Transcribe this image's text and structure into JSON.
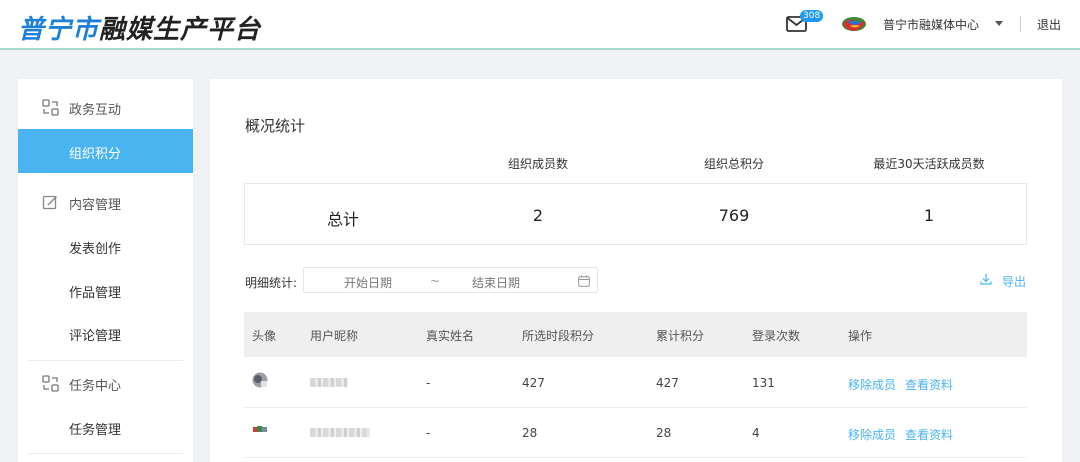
{
  "header": {
    "logo_part1": "普宁市",
    "logo_part2": "融媒生产平台",
    "mail_badge": "308",
    "org_name": "普宁市融媒体中心",
    "logout": "退出"
  },
  "sidebar": {
    "groups": [
      {
        "label": "政务互动",
        "icon": "exchange-icon",
        "items": [
          {
            "label": "组织积分",
            "active": true
          }
        ]
      },
      {
        "label": "内容管理",
        "icon": "edit-icon",
        "items": [
          {
            "label": "发表创作"
          },
          {
            "label": "作品管理"
          },
          {
            "label": "评论管理"
          }
        ]
      },
      {
        "label": "任务中心",
        "icon": "exchange-icon",
        "items": [
          {
            "label": "任务管理"
          }
        ]
      }
    ]
  },
  "main": {
    "title": "概况统计",
    "stat_headers": [
      "组织成员数",
      "组织总积分",
      "最近30天活跃成员数"
    ],
    "stat_row_label": "总计",
    "stat_values": [
      "2",
      "769",
      "1"
    ],
    "detail_label": "明细统计:",
    "date_start_placeholder": "开始日期",
    "date_sep": "~",
    "date_end_placeholder": "结束日期",
    "export_label": "导出",
    "table": {
      "columns": [
        "头像",
        "用户昵称",
        "真实姓名",
        "所选时段积分",
        "累计积分",
        "登录次数",
        "操作"
      ],
      "rows": [
        {
          "real_name": "-",
          "period_points": "427",
          "total_points": "427",
          "logins": "131",
          "action_remove": "移除成员",
          "action_view": "查看资料"
        },
        {
          "real_name": "-",
          "period_points": "28",
          "total_points": "28",
          "logins": "4",
          "action_remove": "移除成员",
          "action_view": "查看资料"
        }
      ]
    }
  },
  "colors": {
    "accent": "#4ab4f1",
    "logo_blue": "#1e7fd8",
    "active_bg": "#4ab4f1"
  }
}
